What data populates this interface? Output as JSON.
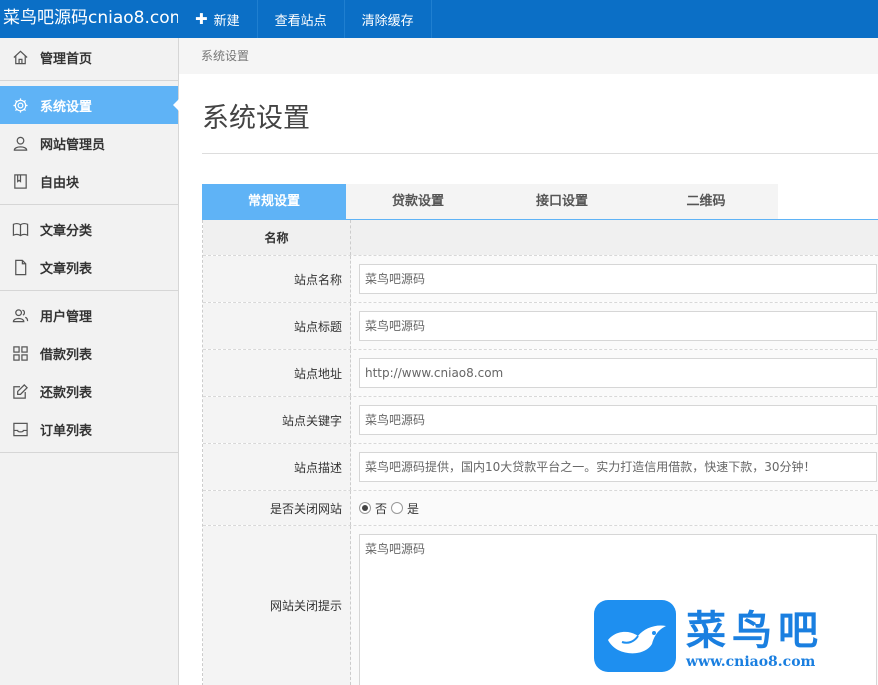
{
  "header": {
    "brand": "菜鸟吧源码cniao8.com",
    "nav": [
      {
        "icon": "plus-icon",
        "label": "新建"
      },
      {
        "label": "查看站点"
      },
      {
        "label": "清除缓存"
      }
    ]
  },
  "sidebar": {
    "items": [
      {
        "icon": "home-icon",
        "label": "管理首页"
      },
      {
        "icon": "gear-icon",
        "label": "系统设置",
        "active": true
      },
      {
        "icon": "user-icon",
        "label": "网站管理员"
      },
      {
        "icon": "book-icon",
        "label": "自由块"
      },
      {
        "icon": "open-book-icon",
        "label": "文章分类"
      },
      {
        "icon": "document-icon",
        "label": "文章列表"
      },
      {
        "icon": "users-icon",
        "label": "用户管理"
      },
      {
        "icon": "grid-icon",
        "label": "借款列表"
      },
      {
        "icon": "edit-icon",
        "label": "还款列表"
      },
      {
        "icon": "inbox-icon",
        "label": "订单列表"
      }
    ]
  },
  "breadcrumb": "系统设置",
  "page_title": "系统设置",
  "tabs": [
    {
      "label": "常规设置",
      "active": true
    },
    {
      "label": "贷款设置"
    },
    {
      "label": "接口设置"
    },
    {
      "label": "二维码"
    }
  ],
  "form": {
    "header_label": "名称",
    "fields": [
      {
        "label": "站点名称",
        "value": "菜鸟吧源码"
      },
      {
        "label": "站点标题",
        "value": "菜鸟吧源码"
      },
      {
        "label": "站点地址",
        "value": "http://www.cniao8.com"
      },
      {
        "label": "站点关键字",
        "value": "菜鸟吧源码"
      },
      {
        "label": "站点描述",
        "value": "菜鸟吧源码提供，国内10大贷款平台之一。实力打造信用借款，快速下款，30分钟！"
      }
    ],
    "close_site": {
      "label": "是否关闭网站",
      "options": [
        "否",
        "是"
      ],
      "selected": "否"
    },
    "close_tip": {
      "label": "网站关闭提示",
      "value": "菜鸟吧源码"
    }
  },
  "watermark": {
    "text": "菜鸟吧",
    "url": "www.cniao8.com"
  },
  "colors": {
    "topbar": "#0b6fc6",
    "accent": "#5fb3f6",
    "brand_blue": "#1a7fe0"
  }
}
